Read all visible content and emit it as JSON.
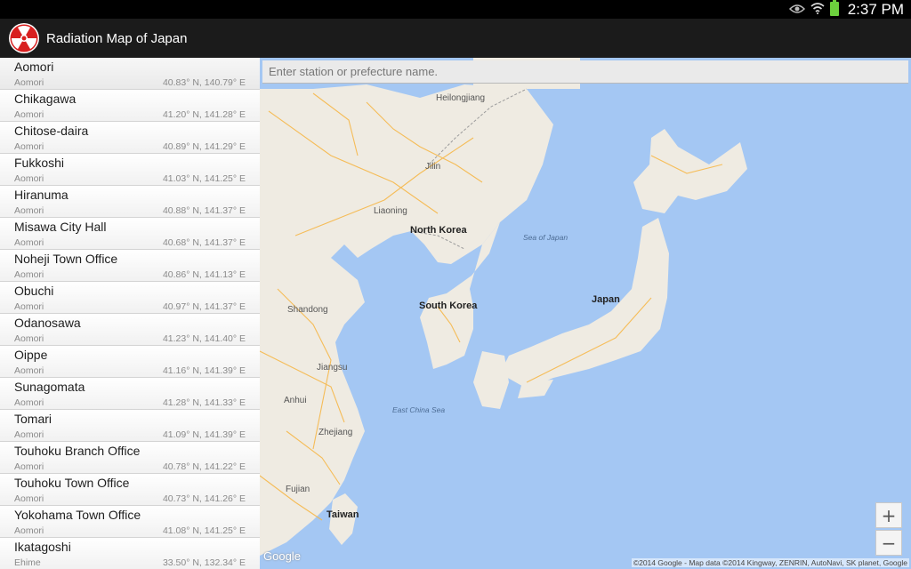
{
  "status_bar": {
    "time": "2:37 PM",
    "icons": [
      "eye-icon",
      "wifi-icon",
      "battery-icon"
    ]
  },
  "app": {
    "title": "Radiation Map of Japan",
    "icon": "radiation-trefoil-icon",
    "colors": {
      "icon_red": "#d81f1f",
      "action_bar": "#1b1b1b"
    }
  },
  "search": {
    "placeholder": "Enter station or prefecture name."
  },
  "stations": [
    {
      "name": "Aomori",
      "prefecture": "Aomori",
      "coords": "40.83° N, 140.79° E"
    },
    {
      "name": "Chikagawa",
      "prefecture": "Aomori",
      "coords": "41.20° N, 141.28° E"
    },
    {
      "name": "Chitose-daira",
      "prefecture": "Aomori",
      "coords": "40.89° N, 141.29° E"
    },
    {
      "name": "Fukkoshi",
      "prefecture": "Aomori",
      "coords": "41.03° N, 141.25° E"
    },
    {
      "name": "Hiranuma",
      "prefecture": "Aomori",
      "coords": "40.88° N, 141.37° E"
    },
    {
      "name": "Misawa City Hall",
      "prefecture": "Aomori",
      "coords": "40.68° N, 141.37° E"
    },
    {
      "name": "Noheji Town Office",
      "prefecture": "Aomori",
      "coords": "40.86° N, 141.13° E"
    },
    {
      "name": "Obuchi",
      "prefecture": "Aomori",
      "coords": "40.97° N, 141.37° E"
    },
    {
      "name": "Odanosawa",
      "prefecture": "Aomori",
      "coords": "41.23° N, 141.40° E"
    },
    {
      "name": "Oippe",
      "prefecture": "Aomori",
      "coords": "41.16° N, 141.39° E"
    },
    {
      "name": "Sunagomata",
      "prefecture": "Aomori",
      "coords": "41.28° N, 141.33° E"
    },
    {
      "name": "Tomari",
      "prefecture": "Aomori",
      "coords": "41.09° N, 141.39° E"
    },
    {
      "name": "Touhoku Branch Office",
      "prefecture": "Aomori",
      "coords": "40.78° N, 141.22° E"
    },
    {
      "name": "Touhoku Town Office",
      "prefecture": "Aomori",
      "coords": "40.73° N, 141.26° E"
    },
    {
      "name": "Yokohama Town Office",
      "prefecture": "Aomori",
      "coords": "41.08° N, 141.25° E"
    },
    {
      "name": "Ikatagoshi",
      "prefecture": "Ehime",
      "coords": "33.50° N, 132.34° E"
    }
  ],
  "map": {
    "labels": {
      "heilongjiang": "Heilongjiang",
      "jilin": "Jilin",
      "liaoning": "Liaoning",
      "north_korea": "North Korea",
      "sea_of_japan": "Sea of Japan",
      "japan": "Japan",
      "south_korea": "South Korea",
      "shandong": "Shandong",
      "jiangsu": "Jiangsu",
      "anhui": "Anhui",
      "east_china_sea": "East China Sea",
      "zhejiang": "Zhejiang",
      "fujian": "Fujian",
      "taiwan": "Taiwan"
    },
    "zoom_in": "+",
    "zoom_out": "−",
    "logo": "Google",
    "attribution": "©2014 Google - Map data ©2014 Kingway, ZENRIN, AutoNavi, SK planet, Google",
    "colors": {
      "water": "#a4c7f3",
      "land": "#efebe2",
      "roads": "#f6b84a"
    }
  }
}
